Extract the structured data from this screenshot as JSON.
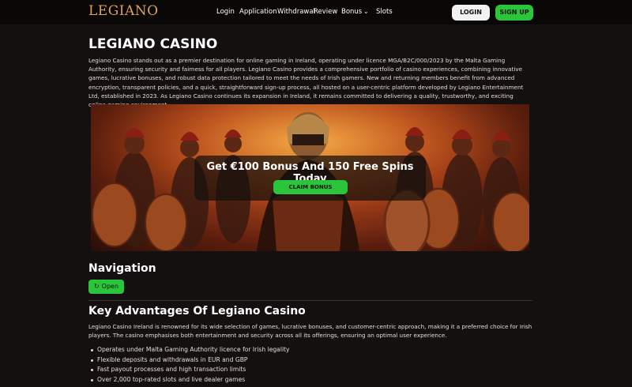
{
  "header": {
    "logo": "LEGIANO",
    "nav": [
      "Login",
      "Application",
      "Withdrawal",
      "Review",
      "Bonus",
      "Slots"
    ],
    "login_label": "LOGIN",
    "signup_label": "SIGN UP"
  },
  "main": {
    "title": "LEGIANO CASINO",
    "intro": "Legiano Casino stands out as a premier destination for online gaming in Ireland, operating under licence MGA/B2C/000/2023 by the Malta Gaming Authority, ensuring security and fairness for all players. Legiano Casino provides a comprehensive portfolio of casino experiences, combining innovative games, lucrative bonuses, and robust data protection tailored to meet the needs of Irish gamers. New and returning members benefit from advanced encryption, transparent policies, and a quick, straightforward sign-up process, all hosted on a user-centric platform developed by Legiano Entertainment Ltd, established in 2023. As Legiano Casino continues its expansion in Ireland, it remains committed to delivering a quality, trustworthy, and exciting online gaming environment.",
    "promo": {
      "title": "Get €100 Bonus And 150 Free Spins Today",
      "button": "CLAIM BONUS"
    },
    "navigation_heading": "Navigation",
    "open_label": "Open",
    "advantages_heading": "Key Advantages Of Legiano Casino",
    "advantages_text": "Legiano Casino Ireland is renowned for its wide selection of games, lucrative bonuses, and customer-centric approach, making it a preferred choice for Irish players. The casino emphasises both entertainment and security across all its offerings, ensuring an optimal user experience.",
    "advantages": [
      "Operates under Malta Gaming Authority licence for Irish legality",
      "Flexible deposits and withdrawals in EUR and GBP",
      "Fast payout processes and high transaction limits",
      "Over 2,000 top-rated slots and live dealer games"
    ]
  },
  "colors": {
    "accent_green": "#2ac53a",
    "logo_gold": "#d9a25a",
    "background": "#141010"
  }
}
